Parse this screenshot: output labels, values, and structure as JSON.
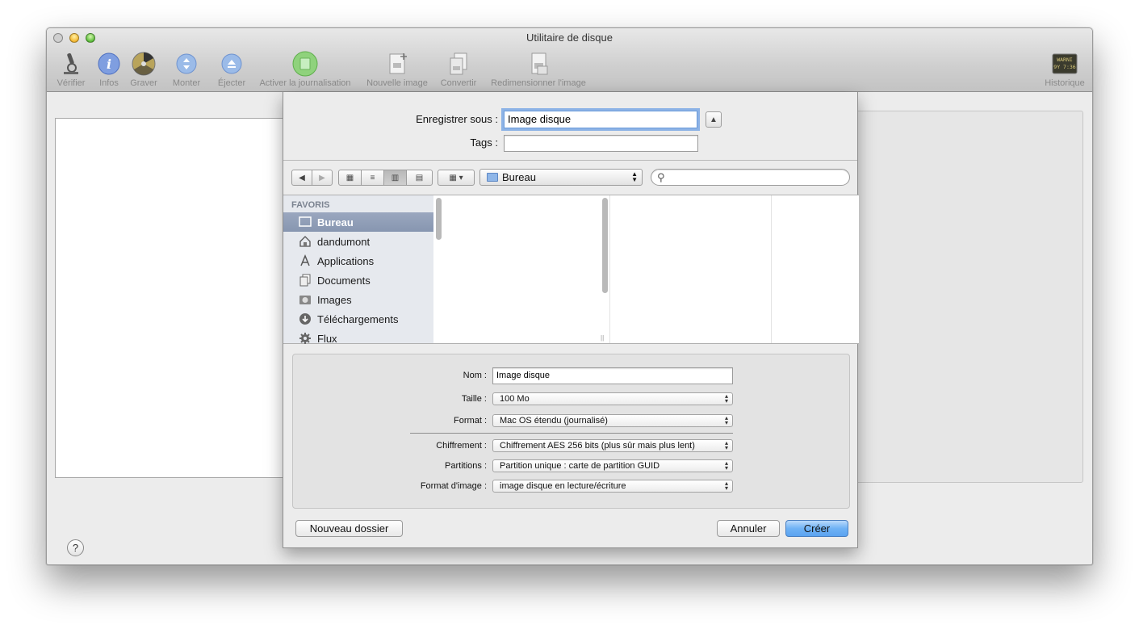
{
  "window": {
    "title": "Utilitaire de disque"
  },
  "toolbar": {
    "items": [
      {
        "label": "Vérifier",
        "icon": "microscope-icon"
      },
      {
        "label": "Infos",
        "icon": "info-icon"
      },
      {
        "label": "Graver",
        "icon": "burn-icon"
      },
      {
        "label": "Monter",
        "icon": "mount-icon"
      },
      {
        "label": "Éjecter",
        "icon": "eject-icon"
      },
      {
        "label": "Activer la journalisation",
        "icon": "journal-icon"
      },
      {
        "label": "Nouvelle image",
        "icon": "new-image-icon"
      },
      {
        "label": "Convertir",
        "icon": "convert-icon"
      },
      {
        "label": "Redimensionner l'image",
        "icon": "resize-image-icon"
      }
    ],
    "historique": {
      "label": "Historique",
      "icon": "log-icon",
      "screen_text": "WARNI\n9Y 7:36"
    }
  },
  "sheet": {
    "save_as_label": "Enregistrer sous :",
    "save_as_value": "Image disque",
    "tags_label": "Tags :",
    "tags_value": "",
    "location": "Bureau",
    "search_placeholder": "",
    "sidebar": {
      "header": "FAVORIS",
      "items": [
        {
          "label": "Bureau",
          "icon": "desktop-icon",
          "selected": true
        },
        {
          "label": "dandumont",
          "icon": "home-icon",
          "selected": false
        },
        {
          "label": "Applications",
          "icon": "applications-icon",
          "selected": false
        },
        {
          "label": "Documents",
          "icon": "documents-icon",
          "selected": false
        },
        {
          "label": "Images",
          "icon": "camera-icon",
          "selected": false
        },
        {
          "label": "Téléchargements",
          "icon": "download-icon",
          "selected": false
        },
        {
          "label": "Flux",
          "icon": "gear-icon",
          "selected": false
        }
      ]
    },
    "options": {
      "nom_label": "Nom :",
      "nom_value": "Image disque",
      "taille_label": "Taille :",
      "taille_value": "100 Mo",
      "format_label": "Format :",
      "format_value": "Mac OS étendu (journalisé)",
      "chiffrement_label": "Chiffrement :",
      "chiffrement_value": "Chiffrement AES 256 bits (plus sûr mais plus lent)",
      "partitions_label": "Partitions :",
      "partitions_value": "Partition unique : carte de partition GUID",
      "format_image_label": "Format d'image :",
      "format_image_value": "image disque en lecture/écriture"
    },
    "buttons": {
      "new_folder": "Nouveau dossier",
      "cancel": "Annuler",
      "create": "Créer"
    }
  },
  "help_label": "?"
}
